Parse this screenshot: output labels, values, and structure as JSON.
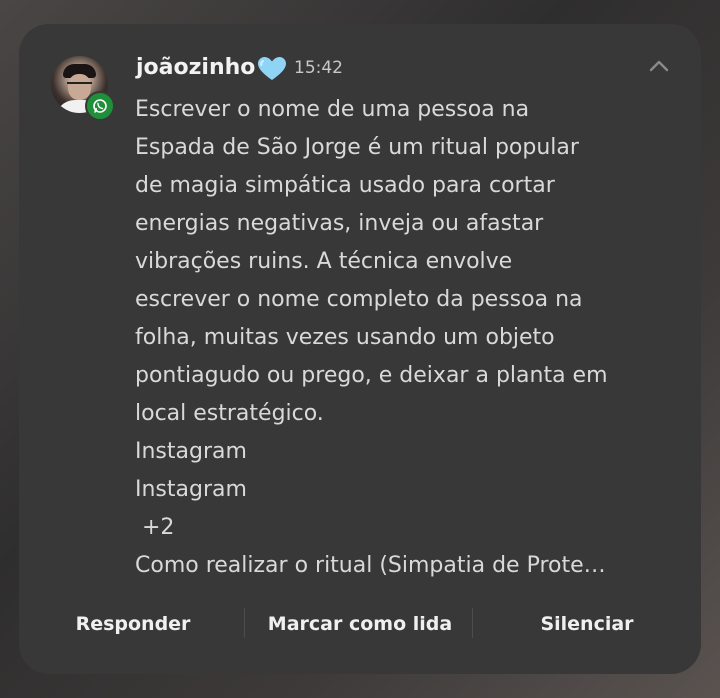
{
  "notification": {
    "sender": "joãozinho",
    "time": "15:42",
    "app_icon": "whatsapp-icon",
    "emoji": "light-blue-heart",
    "message_lines": [
      "Escrever o nome de uma pessoa na",
      "Espada de São Jorge é um ritual popular",
      "de magia simpática usado para cortar",
      "energias negativas, inveja ou afastar",
      "vibrações ruins. A técnica envolve",
      "escrever o nome completo da pessoa na",
      "folha, muitas vezes usando um objeto",
      "pontiagudo ou prego, e deixar a planta em",
      "local estratégico.",
      "Instagram",
      "Instagram",
      " +2",
      "Como realizar o ritual (Simpatia de Prote…"
    ],
    "actions": {
      "reply": "Responder",
      "mark_read": "Marcar como lida",
      "mute": "Silenciar"
    }
  },
  "colors": {
    "card_bg": "#383838",
    "text_primary": "#f2f2f2",
    "text_body": "#d9d9d9",
    "whatsapp_green": "#1f8f3a",
    "heart": "#8fd3f5"
  }
}
